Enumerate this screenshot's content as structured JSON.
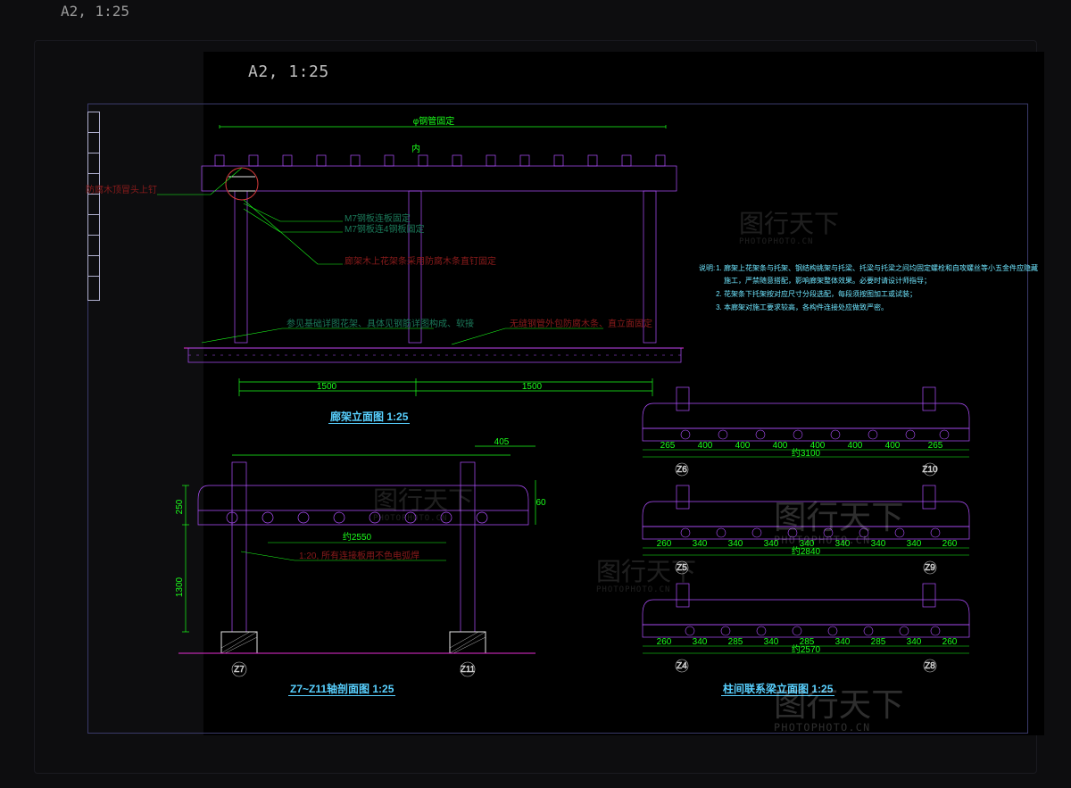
{
  "outer_title": "A2,  1:25",
  "inner_title": "A2,  1:25",
  "views": {
    "elevation": {
      "title": "廊架立面图",
      "scale": "1:25"
    },
    "section": {
      "title": "Z7~Z11轴剖面图",
      "scale": "1:25"
    },
    "beam_elev": {
      "title": "柱间联系梁立面图",
      "scale": "1:25"
    }
  },
  "notes": {
    "header": "说明:",
    "items": [
      "廊架上花架条与托架、钢结构挑架与托梁、托梁与托梁之间均固定螺栓和自攻螺丝等小五金件应隐藏施工，严禁随意搭配，影响廊架整体效果。必要时请设计师指导；",
      "花架条下托架按对应尺寸分段选配，每段须按图加工或试装；",
      "本廊架对施工要求较高，各构件连接处应做致严密。"
    ]
  },
  "leaders": {
    "top1": "φ钢管固定",
    "dim_note": "内",
    "l1": "防腐木顶冒头上钉",
    "l2": "M7钢板连板固定",
    "l3": "M7钢板连4钢板固定",
    "l4": "廊架木上花架条采用防腐木条直钉固定",
    "base_l": "参见基础详图花架、具体见钢筋详图构成、软接",
    "base_r": "无缝钢管外包防腐木条、直立面固定"
  },
  "section_leaders": {
    "mid": "约2550",
    "sub": "1:20, 所有连接板用不色电弧焊"
  },
  "dims": {
    "elev_bottom": [
      "1500",
      "1500"
    ],
    "sect_left": [
      "250",
      "1300"
    ],
    "sect_top_right": "405",
    "sect_right_tag": "60",
    "beamA": {
      "len": "约3100",
      "segs": [
        "265",
        "400",
        "400",
        "400",
        "400",
        "400",
        "400",
        "265"
      ]
    },
    "beamB": {
      "len": "约2840",
      "segs": [
        "260",
        "340",
        "340",
        "340",
        "340",
        "340",
        "340",
        "340",
        "260"
      ]
    },
    "beamC": {
      "len": "约2570",
      "segs": [
        "260",
        "340",
        "285",
        "340",
        "285",
        "340",
        "285",
        "340",
        "260"
      ]
    },
    "grids": {
      "sect_l": "Z7",
      "sect_r": "Z11",
      "bA_l": "Z6",
      "bA_r": "Z10",
      "bB_l": "Z5",
      "bB_r": "Z9",
      "bC_l": "Z4",
      "bC_r": "Z8"
    }
  },
  "watermark": {
    "brand": "图行天下",
    "url": "PHOTOPHOTO.CN"
  }
}
